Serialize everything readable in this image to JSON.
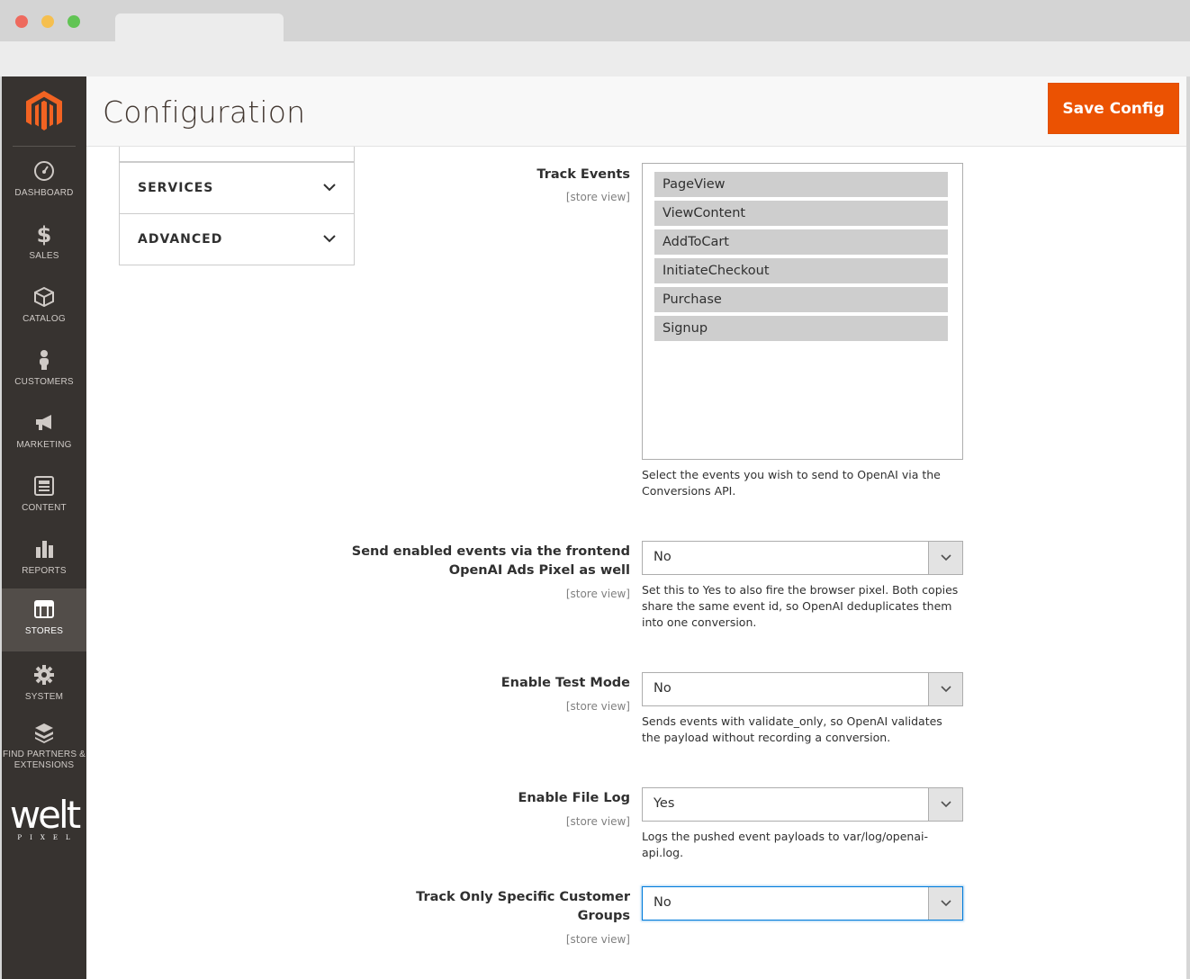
{
  "page": {
    "title": "Configuration",
    "save_label": "Save Config"
  },
  "nav": {
    "items": [
      {
        "label": "DASHBOARD",
        "icon": "dashboard-icon"
      },
      {
        "label": "SALES",
        "icon": "dollar-icon"
      },
      {
        "label": "CATALOG",
        "icon": "cube-icon"
      },
      {
        "label": "CUSTOMERS",
        "icon": "person-icon"
      },
      {
        "label": "MARKETING",
        "icon": "megaphone-icon"
      },
      {
        "label": "CONTENT",
        "icon": "content-icon"
      },
      {
        "label": "REPORTS",
        "icon": "bar-chart-icon"
      },
      {
        "label": "STORES",
        "icon": "store-icon"
      },
      {
        "label": "SYSTEM",
        "icon": "gear-icon"
      },
      {
        "label": "FIND PARTNERS & EXTENSIONS",
        "icon": "boxes-icon"
      }
    ],
    "brand": {
      "word": "welt",
      "sub": "PIXEL"
    },
    "colors": {
      "sidebar": "#373330",
      "active": "#524d49",
      "accent": "#eb5202"
    }
  },
  "tabs": [
    {
      "label": "SERVICES"
    },
    {
      "label": "ADVANCED"
    }
  ],
  "scope_text": "[store view]",
  "fields": {
    "track_events": {
      "label": "Track Events",
      "options": [
        "PageView",
        "ViewContent",
        "AddToCart",
        "InitiateCheckout",
        "Purchase",
        "Signup"
      ],
      "note": "Select the events you wish to send to OpenAI via the Conversions API."
    },
    "frontend_pixel": {
      "label": "Send enabled events via the frontend OpenAI Ads Pixel as well",
      "value": "No",
      "note": "Set this to Yes to also fire the browser pixel. Both copies share the same event id, so OpenAI deduplicates them into one conversion."
    },
    "test_mode": {
      "label": "Enable Test Mode",
      "value": "No",
      "note": "Sends events with validate_only, so OpenAI validates the payload without recording a conversion."
    },
    "file_log": {
      "label": "Enable File Log",
      "value": "Yes",
      "note": "Logs the pushed event payloads to var/log/openai-api.log."
    },
    "customer_groups": {
      "label": "Track Only Specific Customer Groups",
      "value": "No"
    }
  }
}
